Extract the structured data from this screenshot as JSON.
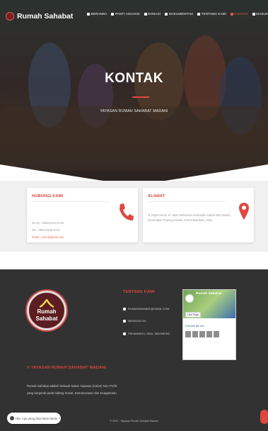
{
  "brand": {
    "name": "Rumah Sahabat"
  },
  "nav": [
    {
      "label": "BERANDA"
    },
    {
      "label": "PANTI ASUHAN"
    },
    {
      "label": "DONASI"
    },
    {
      "label": "DOKUMENTASI"
    },
    {
      "label": "TENTANG KAMI"
    },
    {
      "label": "KONTAK"
    },
    {
      "label": "MASUK"
    }
  ],
  "hero": {
    "title": "KONTAK",
    "subtitle": "YAYASAN RUMAH SAHABAT MADANI"
  },
  "contact": {
    "hubungi": {
      "title": "HUBUNGI KAMI",
      "phone": "No Hp : 0853-5133-0744",
      "wa": "WA : 0853-5133-0744",
      "email": "Email : yrsm@gmail.com"
    },
    "alamat": {
      "title": "ALAMAT",
      "address": "Jl. Rajar Harus 47 Jalan Mekarsari Kelurahan Labuh Baru Barat, Kecamatan Payung Sekaki, Kota Pekanbaru, Riau"
    }
  },
  "footer": {
    "logo_line1": "Rumah",
    "logo_line2": "Sahabat",
    "org_title": "© YAYASAN RUMAH SAHABAT MADANI",
    "org_desc": "Rumah Sahabat adalah Sebuah Nama Yayasan (Calon) Non Profit yang bergerak pada bidang Sosial, Kemanusiaan dan Keagamaan.",
    "tentang": {
      "title": "TENTANG KAMI",
      "email": "RUMAHSAHABAT@GMAIL.COM",
      "phone": "085352111744",
      "city": "PEKANBARU, RIAU, INDONESIA"
    },
    "fb": {
      "page_name": "Rumah Sabahat",
      "like": "Like Page",
      "friends": "5 friends like this"
    },
    "copyright": "© 2020 - Yayasan Rumah Sahabat Madani"
  },
  "chat": {
    "label": "Hai, Apa yang bisa kami bantu ?"
  },
  "colors": {
    "accent": "#e0473e",
    "footer_bg": "#333232",
    "section_bg": "#f0f0f0"
  }
}
